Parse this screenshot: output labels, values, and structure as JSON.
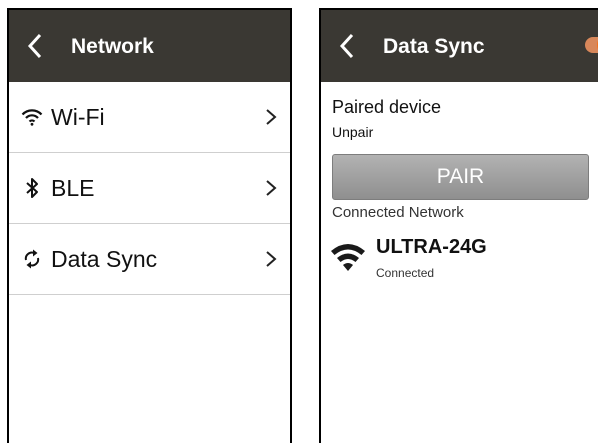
{
  "network_screen": {
    "title": "Network",
    "items": [
      {
        "label": "Wi-Fi",
        "icon": "wifi-icon"
      },
      {
        "label": "BLE",
        "icon": "bluetooth-icon"
      },
      {
        "label": "Data Sync",
        "icon": "sync-icon"
      }
    ]
  },
  "sync_screen": {
    "title": "Data Sync",
    "toggle_on": true,
    "paired_device_label": "Paired device",
    "unpair_label": "Unpair",
    "pair_button_label": "PAIR",
    "connected_network_label": "Connected Network",
    "network_name": "ULTRA-24G",
    "network_status": "Connected"
  },
  "colors": {
    "header_bg": "#3a3833",
    "toggle_accent": "#f2711c",
    "pair_button": "#a0a0a0",
    "wifi_icon": "#1a1a1a"
  }
}
